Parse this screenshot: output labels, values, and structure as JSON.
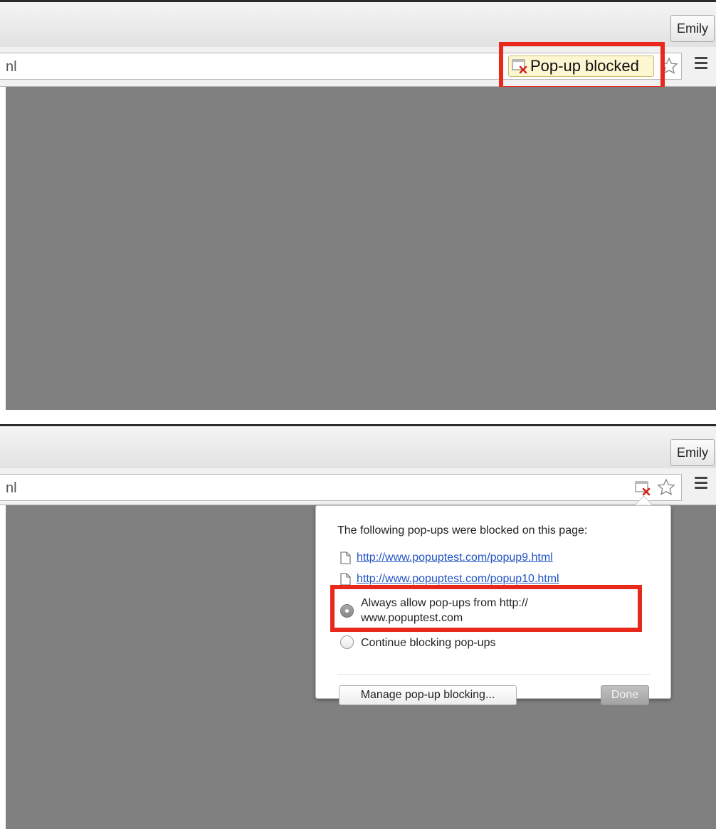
{
  "profile_name": "Emily",
  "omnibox_text_fragment": "nl",
  "top": {
    "blocked_label": "Pop-up blocked"
  },
  "bubble": {
    "title": "The following pop-ups were blocked on this page:",
    "blocked_links": [
      "http://www.popuptest.com/popup9.html",
      "http://www.popuptest.com/popup10.html"
    ],
    "options": [
      {
        "line1": "Always allow pop-ups from http://",
        "line2": "www.popuptest.com",
        "checked": true
      },
      {
        "line1": "Continue blocking pop-ups",
        "checked": false
      }
    ],
    "manage_label": "Manage pop-up blocking...",
    "done_label": "Done"
  },
  "colors": {
    "highlight": "#e8281b",
    "page_background": "#808080",
    "link": "#2254c4",
    "blocked_chip": "#fcf6d1"
  }
}
